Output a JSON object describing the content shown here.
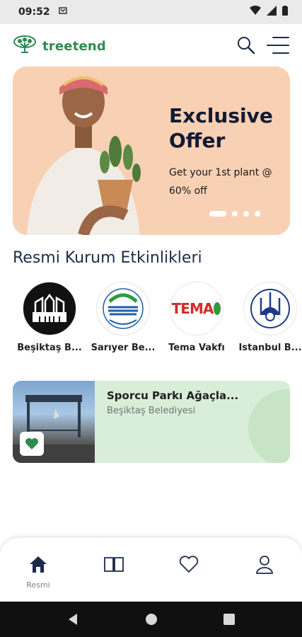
{
  "status_bar": {
    "time": "09:52"
  },
  "header": {
    "logo_text": "treetend"
  },
  "banner": {
    "title": "Exclusive Offer",
    "subtitle": "Get your 1st plant @ 60% off",
    "active_slide": 1,
    "slide_count": 4
  },
  "section": {
    "title": "Resmi Kurum Etkinlikleri"
  },
  "organizations": [
    {
      "label": "Beşiktaş B..."
    },
    {
      "label": "Sarıyer Be..."
    },
    {
      "label": "Tema Vakfı",
      "logo_text": "TEMA"
    },
    {
      "label": "İstanbul B..."
    }
  ],
  "event_card": {
    "title": "Sporcu Parkı Ağaçla...",
    "organization": "Beşiktaş Belediyesi"
  },
  "bottom_nav": {
    "items": [
      {
        "icon": "home-icon",
        "label": "Resmi"
      },
      {
        "icon": "book-icon",
        "label": ""
      },
      {
        "icon": "heart-icon",
        "label": ""
      },
      {
        "icon": "user-icon",
        "label": ""
      }
    ]
  },
  "colors": {
    "brand_green": "#2f8a50",
    "heading_navy": "#1d2b4b",
    "banner_bg": "#f8d0b3",
    "card_bg": "#d9eed8"
  }
}
